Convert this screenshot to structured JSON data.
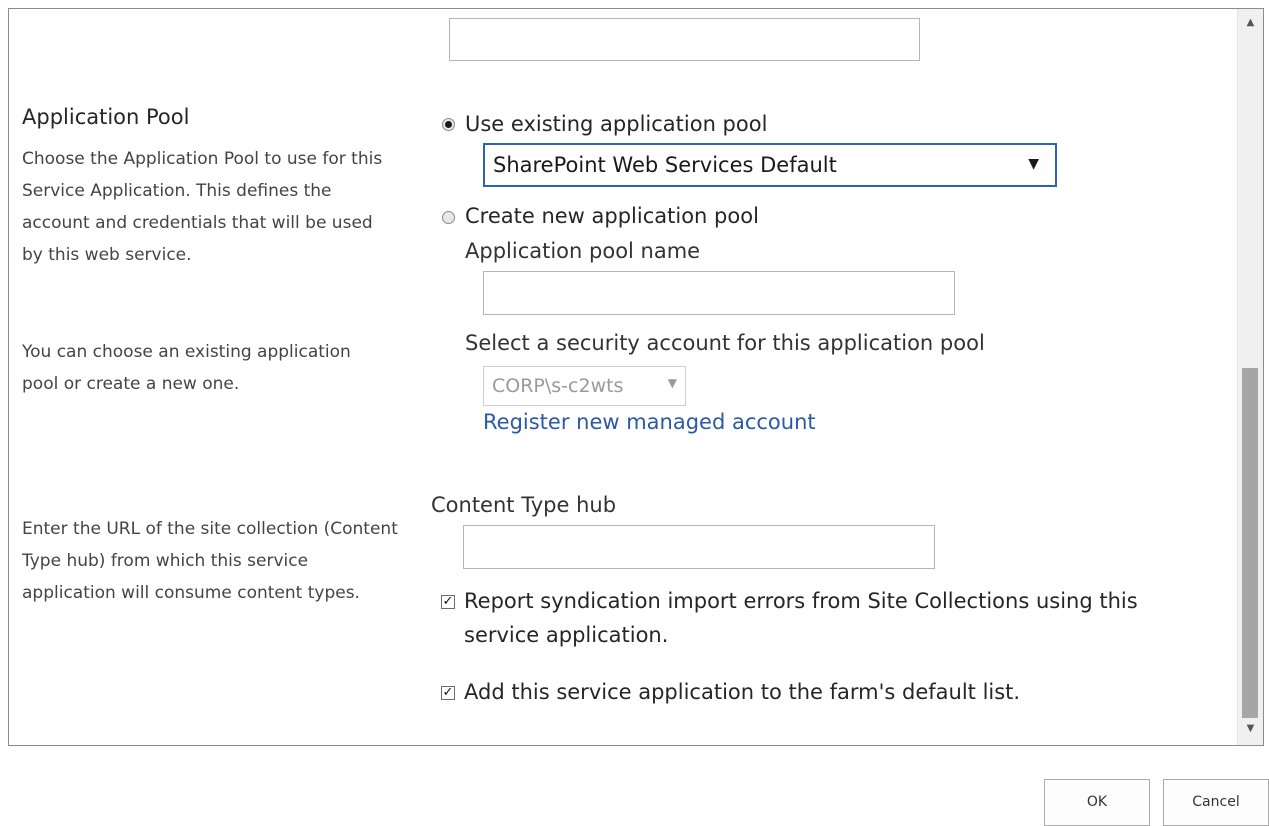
{
  "app_pool": {
    "title": "Application Pool",
    "desc1": "Choose the Application Pool to use for this Service Application.  This defines the account and credentials that will be used by this web service.",
    "desc2": "You can choose an existing application pool or create a new one.",
    "use_existing_label": "Use existing application pool",
    "existing_selected": "SharePoint Web Services Default",
    "create_new_label": "Create new application pool",
    "pool_name_label": "Application pool name",
    "pool_name_value": "",
    "security_account_label": "Select a security account for this application pool",
    "security_account_selected": "CORP\\s-c2wts",
    "register_link": "Register new managed account"
  },
  "content_type": {
    "desc": "Enter the URL of the site collection (Content Type hub) from which this service application will consume content types.",
    "hub_label": "Content Type hub",
    "hub_value": "",
    "report_label": "Report syndication import errors from Site Collections using this",
    "report_label_2": "service application.",
    "report_checked": true,
    "default_list_label": "Add this service application to the farm's default list.",
    "default_list_checked": true
  },
  "top_field": {
    "value": ""
  },
  "buttons": {
    "ok": "OK",
    "cancel": "Cancel"
  }
}
